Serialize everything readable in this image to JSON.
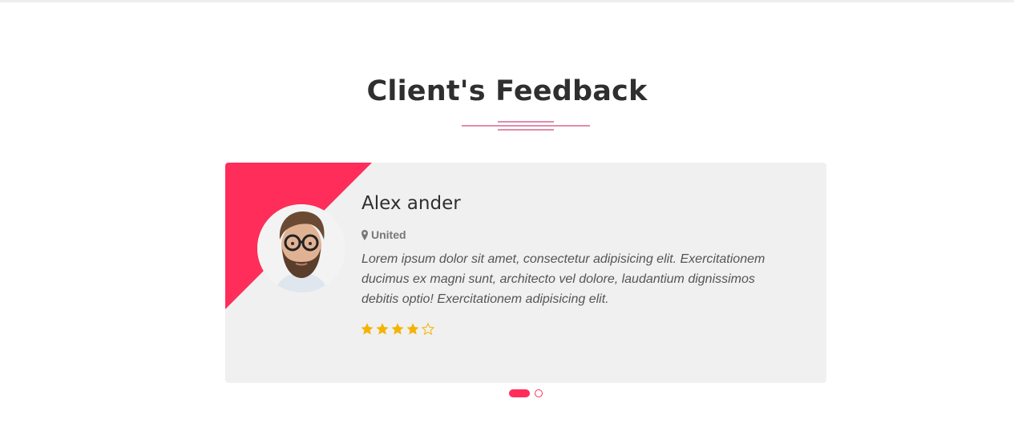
{
  "section": {
    "title": "Client's Feedback"
  },
  "colors": {
    "accent": "#ff2d5a",
    "card_bg": "#f0f0f0",
    "star": "#f5b301",
    "heading": "#2f2f2f",
    "muted": "#777777"
  },
  "testimonial": {
    "name": "Alex ander",
    "location": "United",
    "location_icon": "map-pin-icon",
    "avatar_icon": "avatar-photo",
    "quote": "Lorem ipsum dolor sit amet, consectetur adipisicing elit. Exercitationem ducimus ex magni sunt, architecto vel dolore, laudantium dignissimos debitis optio! Exercitationem adipisicing elit.",
    "rating": 4,
    "rating_max": 5
  },
  "carousel": {
    "slide_count": 2,
    "active_index": 0
  }
}
